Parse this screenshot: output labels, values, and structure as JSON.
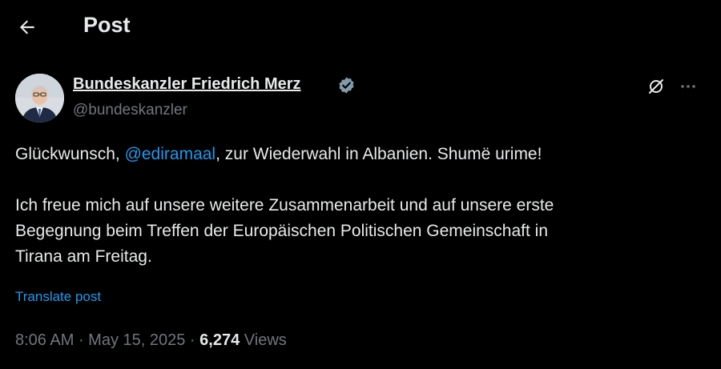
{
  "header": {
    "title": "Post"
  },
  "author": {
    "name": "Bundeskanzler Friedrich Merz",
    "handle": "@bundeskanzler",
    "verified": true
  },
  "tweet": {
    "line1_before": "Glückwunsch, ",
    "mention": "@ediramaal",
    "line1_after": ", zur Wiederwahl in Albanien. Shumë urime!",
    "paragraph2_line1": "Ich freue mich auf unsere weitere Zusammenarbeit und auf unsere erste",
    "paragraph2_line2": "Begegnung beim Treffen der Europäischen Politischen Gemeinschaft in",
    "paragraph2_line3": "Tirana am Freitag."
  },
  "translate_label": "Translate post",
  "meta": {
    "time": "8:06 AM",
    "date": "May 15, 2025",
    "separator": " · ",
    "views_count": "6,274",
    "views_label": "Views"
  },
  "colors": {
    "background": "#000000",
    "text": "#e7e9ea",
    "muted": "#71767b",
    "accent": "#1d9bf0"
  },
  "icons": [
    "back-arrow-icon",
    "verified-badge-icon",
    "grok-icon",
    "more-icon"
  ]
}
